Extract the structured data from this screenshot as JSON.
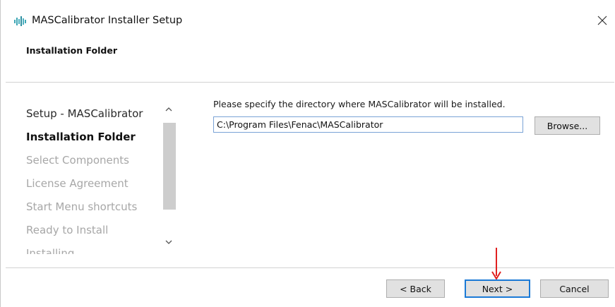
{
  "window": {
    "title": "MASCalibrator Installer Setup",
    "app_icon": "waveform-app-icon",
    "close_icon": "close-icon"
  },
  "header": {
    "page_title": "Installation Folder"
  },
  "steps": {
    "items": [
      {
        "label": "Setup - MASCalibrator",
        "state": "done"
      },
      {
        "label": "Installation Folder",
        "state": "current"
      },
      {
        "label": "Select Components",
        "state": "pending"
      },
      {
        "label": "License Agreement",
        "state": "pending"
      },
      {
        "label": "Start Menu shortcuts",
        "state": "pending"
      },
      {
        "label": "Ready to Install",
        "state": "pending"
      },
      {
        "label": "Installing",
        "state": "pending"
      }
    ],
    "scroll_up_icon": "chevron-up-icon",
    "scroll_down_icon": "chevron-down-icon"
  },
  "main": {
    "prompt": "Please specify the directory where MASCalibrator will be installed.",
    "directory_value": "C:\\Program Files\\Fenac\\MASCalibrator",
    "browse_label": "Browse..."
  },
  "footer": {
    "back_label": "< Back",
    "next_label": "Next >",
    "cancel_label": "Cancel"
  },
  "colors": {
    "focus_border": "#1b7ad6",
    "annotation_arrow": "#e02020",
    "pending_text": "#a7a7a7",
    "icon_teal": "#3fa6b5"
  }
}
